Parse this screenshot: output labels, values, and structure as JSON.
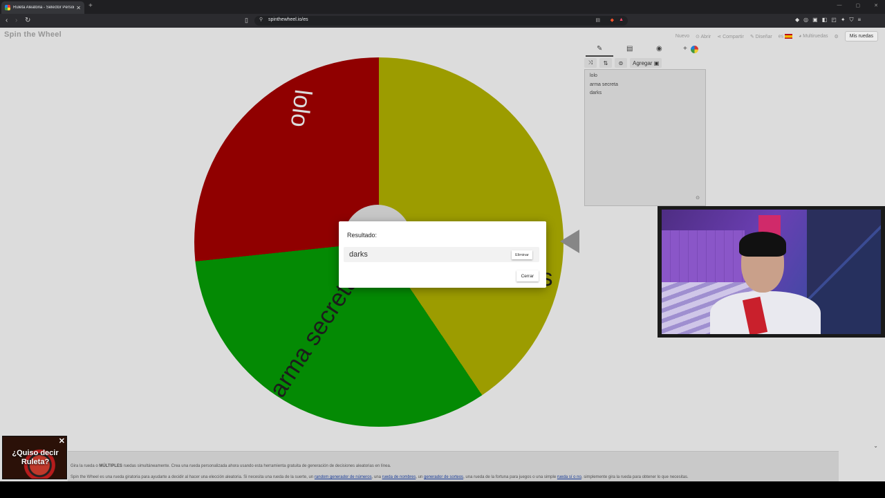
{
  "browser": {
    "tab_title": "Ruleta Aleatoria - Selector Personalizado",
    "url": "spinthewheel.io/es",
    "nav_back": "‹",
    "nav_forward": "›",
    "reload": "↻",
    "new_tab": "+"
  },
  "header": {
    "logo": "Spin the Wheel",
    "nav": {
      "nuevo": "Nuevo",
      "abrir": "Abrir",
      "compartir": "Compartir",
      "disenar": "Diseñar",
      "idioma": "es",
      "multiruedas": "Multiruedas",
      "mis_ruedas": "Mis ruedas"
    }
  },
  "editor": {
    "add_button": "Agregar",
    "add_plus": "+",
    "entries": [
      "lolo",
      "arma secreta",
      "darks"
    ]
  },
  "wheel": {
    "segments": [
      {
        "label": "lolo",
        "color": "#980000"
      },
      {
        "label": "arma secreta",
        "color": "#059205"
      },
      {
        "label": "s",
        "color": "#a5a500"
      }
    ]
  },
  "dialog": {
    "title": "Resultado:",
    "result": "darks",
    "remove_button": "Eliminar",
    "close_button": "Cerrar"
  },
  "ad": {
    "text": "¿Quiso decir Ruleta?",
    "close": "✕"
  },
  "footer": {
    "line1_pre": "Gira la rueda o ",
    "line1_bold": "MÚLTIPLES",
    "line1_post": " ruedas simultáneamente. Crea una rueda personalizada ahora usando esta herramienta gratuita de generación de decisiones aleatorias en línea.",
    "line2_a": "Spin the Wheel es una rueda giratoria para ayudarte a decidir al hacer una elección aleatoria. Si necesita una rueda de la suerte, un ",
    "link1": "random generador de números",
    "line2_b": ", una ",
    "link2": "rueda de nombres",
    "line2_c": ", un ",
    "link3": "generador de sorteos",
    "line2_d": ", una rueda de la fortuna para juegos o una simple ",
    "link4": "rueda sí o no",
    "line2_e": ", simplemente gira la rueda para obtener lo que necesitas."
  },
  "colors": {
    "red": "#980000",
    "green": "#059205",
    "yellow": "#a5a500"
  }
}
